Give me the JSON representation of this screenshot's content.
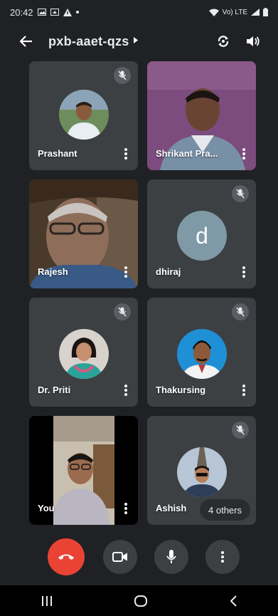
{
  "status_bar": {
    "time": "20:42",
    "network_label": "Vo) LTE"
  },
  "call": {
    "meeting_code": "pxb-aaet-qzs"
  },
  "participants": [
    {
      "name": "Prashant",
      "muted": true,
      "type": "avatar"
    },
    {
      "name": "Shrikant Pra...",
      "muted": false,
      "type": "video"
    },
    {
      "name": "Rajesh",
      "muted": false,
      "type": "video"
    },
    {
      "name": "dhiraj",
      "muted": true,
      "type": "letter",
      "letter": "d"
    },
    {
      "name": "Dr. Priti",
      "muted": true,
      "type": "avatar"
    },
    {
      "name": "Thakursing",
      "muted": true,
      "type": "avatar"
    },
    {
      "name": "You",
      "muted": false,
      "type": "video"
    },
    {
      "name": "Ashish",
      "muted": true,
      "type": "avatar"
    }
  ],
  "others_badge": "4 others",
  "colors": {
    "background": "#202124",
    "tile": "#3c4043",
    "end_call": "#ea4335",
    "avatar_d": "#7f9aa6"
  },
  "icons": {
    "back": "arrow-left-icon",
    "switch_camera": "switch-camera-icon",
    "speaker": "speaker-icon",
    "mute": "mic-off-icon",
    "more": "more-vert-icon",
    "end_call": "call-end-icon",
    "camera": "videocam-icon",
    "mic": "mic-icon"
  }
}
